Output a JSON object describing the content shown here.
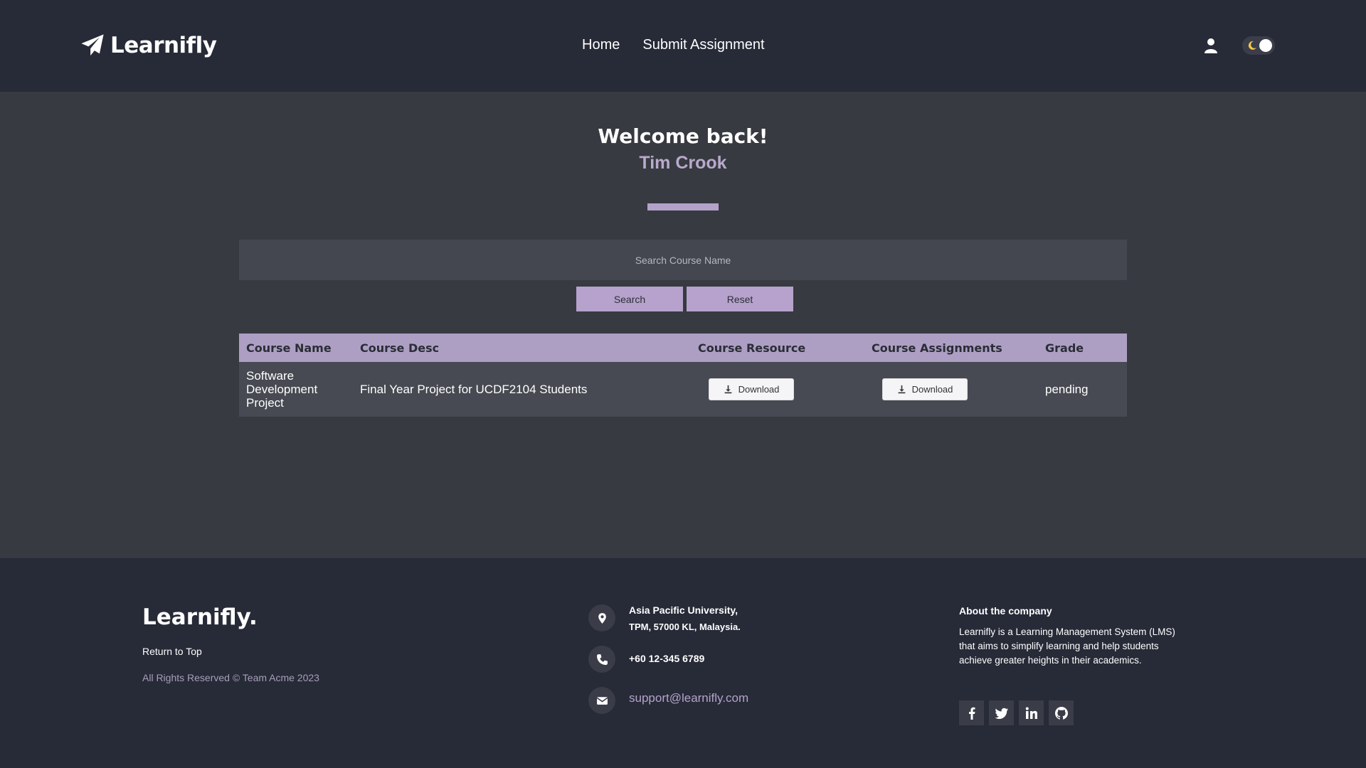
{
  "header": {
    "brand": "Learnifly",
    "nav": [
      {
        "label": "Home"
      },
      {
        "label": "Submit Assignment"
      }
    ],
    "user_icon": "user-icon",
    "theme_toggle_icon": "moon-icon"
  },
  "welcome": {
    "title": "Welcome back!",
    "username": "Tim Crook"
  },
  "search": {
    "placeholder": "Search Course Name",
    "search_label": "Search",
    "reset_label": "Reset"
  },
  "table": {
    "columns": [
      "Course Name",
      "Course Desc",
      "Course Resource",
      "Course Assignments",
      "Grade"
    ],
    "rows": [
      {
        "course_name": "Software Development Project",
        "course_desc": "Final Year Project for UCDF2104 Students",
        "resource_label": "Download",
        "assignments_label": "Download",
        "grade": "pending"
      }
    ]
  },
  "footer": {
    "brand": "Learnifly.",
    "return_top": "Return to Top",
    "rights": "All Rights Reserved © Team Acme 2023",
    "address_line1": "Asia Pacific University,",
    "address_line2": "TPM, 57000 KL, Malaysia.",
    "phone": "+60 12-345 6789",
    "email": "support@learnifly.com",
    "about_title": "About the company",
    "about_text": "Learnifly is a Learning Management System (LMS) that aims to simplify learning and help students achieve greater heights in their academics.",
    "socials": [
      "facebook-icon",
      "twitter-icon",
      "linkedin-icon",
      "github-icon"
    ]
  },
  "colors": {
    "accent": "#b6a2cc",
    "header_bg": "#272a37",
    "body_bg": "#373a40"
  }
}
